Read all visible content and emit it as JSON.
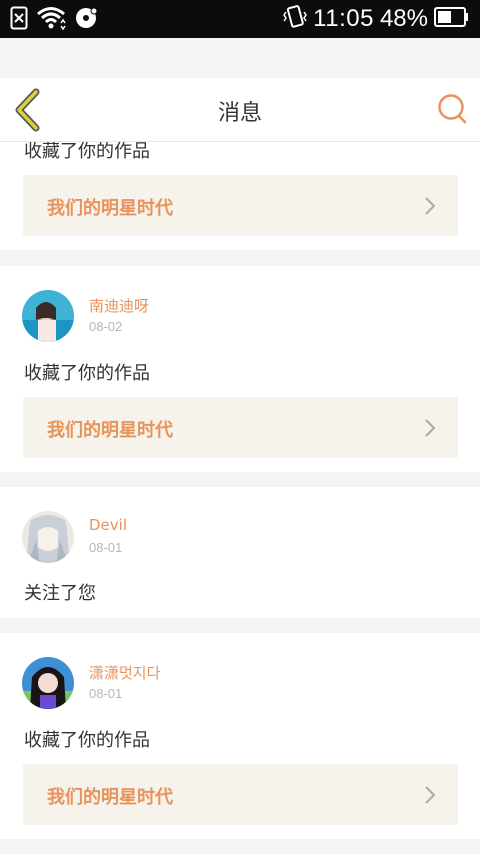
{
  "status_bar": {
    "time": "11:05",
    "battery_percent": "48%",
    "icons": [
      "sim-error-icon",
      "wifi-icon",
      "disk-sync-icon",
      "vibrate-icon",
      "battery-icon"
    ]
  },
  "header": {
    "title": "消息",
    "back_icon": "chevron-left-icon",
    "search_icon": "search-icon"
  },
  "messages": [
    {
      "action": "收藏了你的作品",
      "work_title": "我们的明星时代"
    },
    {
      "user": "南迪迪呀",
      "date": "08-02",
      "action": "收藏了你的作品",
      "work_title": "我们的明星时代"
    },
    {
      "user": "Devil",
      "date": "08-01",
      "action": "关注了您"
    },
    {
      "user": "潇潇멋지다",
      "date": "08-01",
      "action": "收藏了你的作品",
      "work_title": "我们的明星时代"
    }
  ],
  "colors": {
    "accent": "#e8935b",
    "back_icon": "#c9c22c",
    "work_bg": "#f5f3ec",
    "page_bg": "#f4f4f4"
  }
}
